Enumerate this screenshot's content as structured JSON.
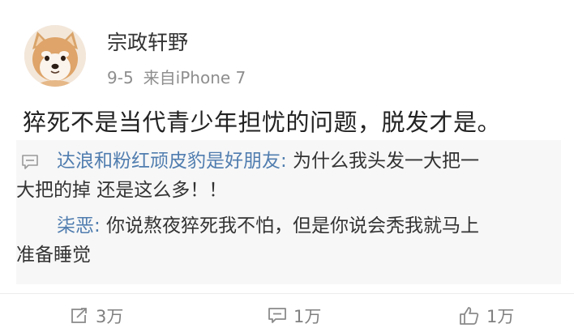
{
  "post": {
    "username": "宗政轩野",
    "time": "9-5",
    "source": "来自iPhone 7",
    "text": "猝死不是当代青少年担忧的问题，脱发才是。"
  },
  "comments": [
    {
      "author": "达浪和粉红顽皮豹是好朋友",
      "separator": ":",
      "text_line1": " 为什么我头发一大把一",
      "text_line2": "大把的掉 还是这么多！！"
    },
    {
      "author": "柒恶",
      "separator": ":",
      "text_line1": " 你说熬夜猝死我不怕，但是你说会秃我就马上",
      "text_line2": "准备睡觉"
    }
  ],
  "actions": {
    "repost_count": "3万",
    "comment_count": "1万",
    "like_count": "1万"
  },
  "icons": {
    "avatar": "shiba-dog-avatar",
    "comment_marker": "comment-bubble-icon",
    "repost": "repost-icon",
    "comment": "comment-icon",
    "like": "thumbs-up-icon"
  },
  "colors": {
    "author_link": "#507daf",
    "text": "#222222",
    "meta": "#8e8e8e",
    "comment_bg": "#f7f7f7"
  }
}
